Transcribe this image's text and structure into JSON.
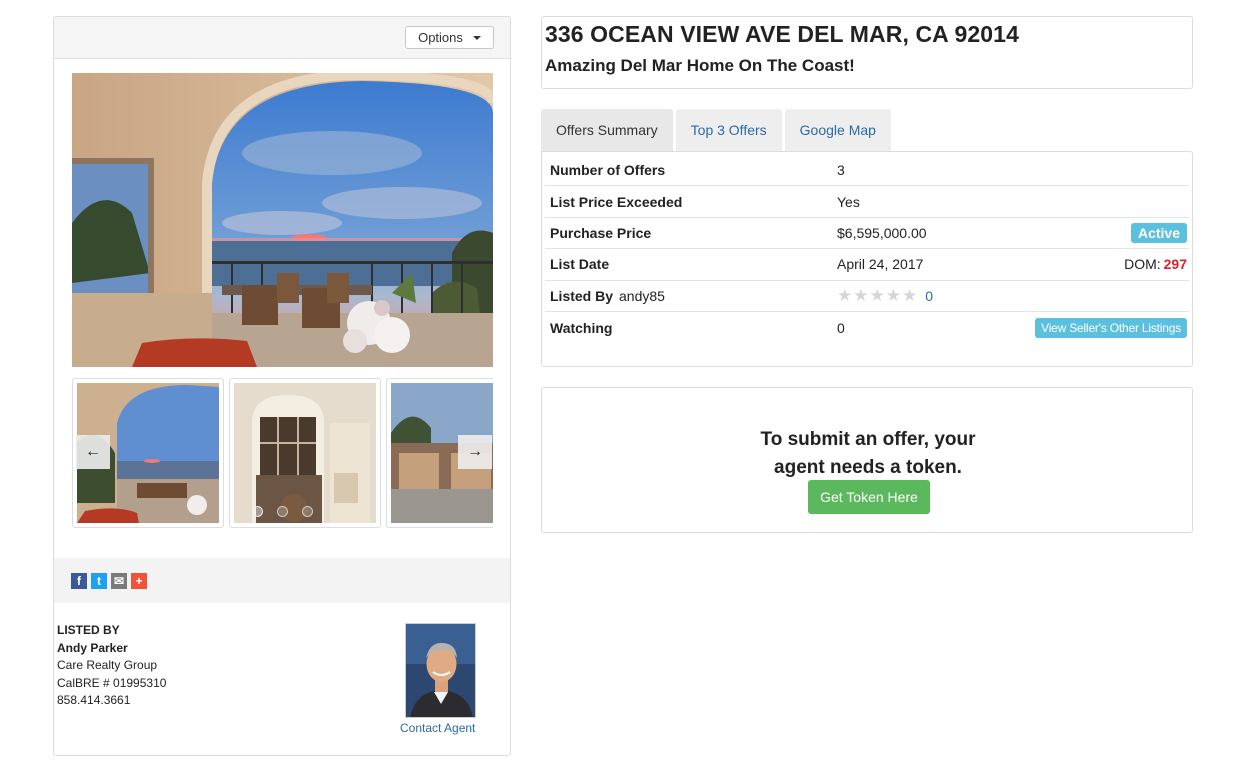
{
  "listing": {
    "title": "336 OCEAN VIEW AVE DEL MAR, CA 92014",
    "subtitle": "Amazing Del Mar Home On The Coast!"
  },
  "gallery": {
    "options_label": "Options",
    "prev_arrow": "←",
    "next_arrow": "→",
    "slides_count": 3,
    "active_slide": 1
  },
  "share_icons": [
    "facebook-icon",
    "twitter-icon",
    "email-icon",
    "plus-icon"
  ],
  "share_glyphs": {
    "facebook": "f",
    "twitter": "t",
    "email": "✉",
    "plus": "+"
  },
  "colors": {
    "facebook": "#3b5998",
    "twitter": "#1da1f2",
    "email": "#7a7a7a",
    "plus": "#f0533a",
    "link": "#2a6aa8",
    "info": "#5bc0de",
    "success": "#5cb85c",
    "danger": "#d9232d"
  },
  "agent": {
    "heading": "LISTED BY",
    "name": "Andy Parker",
    "company": "Care Realty Group",
    "license": "CalBRE # 01995310",
    "phone": "858.414.3661",
    "contact_label": "Contact Agent"
  },
  "tabs": [
    {
      "label": "Offers Summary",
      "active": true
    },
    {
      "label": "Top 3 Offers",
      "active": false
    },
    {
      "label": "Google Map",
      "active": false
    }
  ],
  "summary": {
    "offers_label": "Number of Offers",
    "offers_value": "3",
    "exceeded_label": "List Price Exceeded",
    "exceeded_value": "Yes",
    "price_label": "Purchase Price",
    "price_value": "$6,595,000.00",
    "status_badge": "Active",
    "list_date_label": "List Date",
    "list_date_value": "April 24, 2017",
    "dom_label": "DOM:",
    "dom_value": "297",
    "listed_by_label": "Listed By",
    "listed_by_user": "andy85",
    "rating_stars": 5,
    "rating_filled": 0,
    "rating_count": "0",
    "watching_label": "Watching",
    "watching_value": "0",
    "other_listings_label": "View Seller's Other Listings"
  },
  "token": {
    "line1": "To submit an offer, your",
    "line2": "agent needs a token.",
    "button_label": "Get Token Here"
  }
}
